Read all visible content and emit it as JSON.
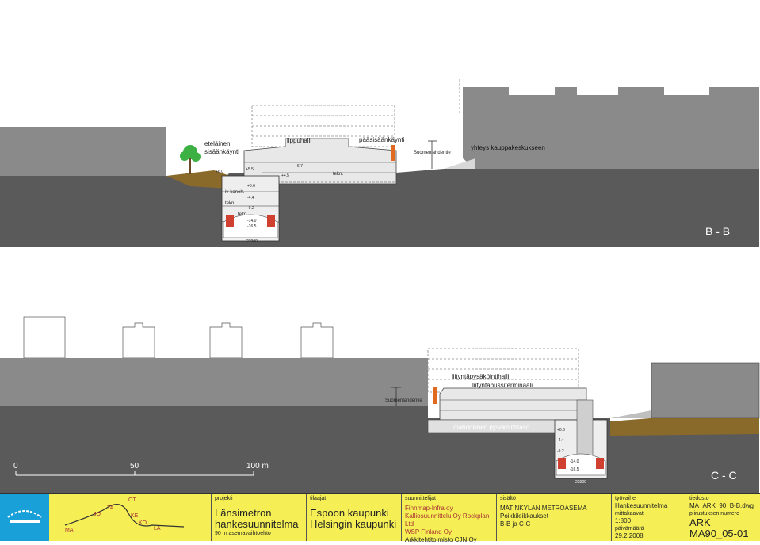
{
  "sections": {
    "bb": {
      "title": "B - B",
      "labels": {
        "south_entrance": [
          "eteläinen",
          "sisäänkäynti"
        ],
        "ticket_hall": "lippuhalli",
        "main_entrance": "pääsisäänkäynti",
        "road": "Suomenlahdentie",
        "mall_link": "yhteys kauppakeskukseen",
        "tech1": "tekn.",
        "ventilation": "iv-koneh.",
        "tech2": "tekn.",
        "tech3": "tekn."
      },
      "levels": [
        "+6.0",
        "+5.5",
        "+4.5",
        "+6.7",
        "+0.6",
        "-4.4",
        "-9.2",
        "-14.0",
        "-16.5"
      ],
      "dimension": "22900"
    },
    "cc": {
      "title": "C - C",
      "labels": {
        "park_ride": "liityntäpysäköintihalli",
        "bus_terminal": "liityntäbussiterminaali",
        "road": "Suomenlahdentie",
        "parking": "mahdollinen pysäköintitaso"
      },
      "levels": [
        "+0.6",
        "-4.4",
        "-9.2",
        "-14.0",
        "-16.5"
      ],
      "dimension": "22900"
    }
  },
  "scalebar": {
    "ticks": [
      "0",
      "50",
      "100 m"
    ]
  },
  "route_map": {
    "stations": [
      "MA",
      "JO",
      "TA",
      "OT",
      "KE",
      "KO",
      "LA"
    ]
  },
  "titleblock": {
    "projekti_label": "projekti",
    "projekti": [
      "Länsimetron",
      "hankesuunnitelma"
    ],
    "projekti_sub": "90 m asemavaihtoehto",
    "tilaajat_label": "tilaajat",
    "tilaajat": [
      "Espoon kaupunki",
      "Helsingin kaupunki"
    ],
    "suunnittelijat_label": "suunnittelijat",
    "suunnittelijat": [
      "Finnmap-Infra oy",
      "Kalliosuunnittelu Oy Rockplan Ltd",
      "WSP Finland Oy",
      "Arkkitehtitoimisto CJN Oy"
    ],
    "sisalto_label": "sisältö",
    "sisalto": [
      "MATINKYLÄN METROASEMA",
      "Poikkileikkaukset",
      "B-B ja C-C"
    ],
    "tyovaihe_label": "työvaihe",
    "tyovaihe": "Hankesuunnitelma",
    "mittakaavat_label": "mittakaavat",
    "mittakaavat": "1:800",
    "paivamaara_label": "päivämäärä",
    "paivamaara": "29.2.2008",
    "tiedosto_label": "tiedosto",
    "tiedosto": "MA_ARK_90_B-B.dwg",
    "piirustus_label": "piirustuksen numero",
    "piirustus_ark": "ARK",
    "piirustus_nro": "MA90_05-01"
  },
  "colors": {
    "ground": "#5a5a5a",
    "building": "#8a8a8a",
    "soil": "#8a6a2a",
    "titleblock": "#f5ef55",
    "logo": "#1aa0d8",
    "accent_orange": "#e06a20",
    "tree": "#3cb043"
  }
}
